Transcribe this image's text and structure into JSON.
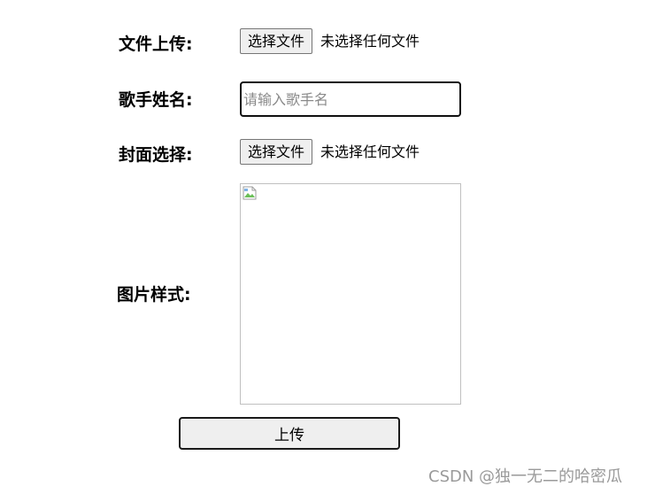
{
  "form": {
    "file_upload": {
      "label": "文件上传:",
      "button_label": "选择文件",
      "status": "未选择任何文件"
    },
    "singer_name": {
      "label": "歌手姓名:",
      "value": "",
      "placeholder": "请输入歌手名"
    },
    "cover_select": {
      "label": "封面选择:",
      "button_label": "选择文件",
      "status": "未选择任何文件"
    },
    "image_style": {
      "label": "图片样式:",
      "icon": "broken-image-icon"
    },
    "submit_label": "上传"
  },
  "watermark": "CSDN @独一无二的哈密瓜",
  "colors": {
    "button_bg": "#efefef",
    "input_border": "#101010",
    "placeholder": "#8a8a8a",
    "watermark": "#9a9a9a"
  }
}
